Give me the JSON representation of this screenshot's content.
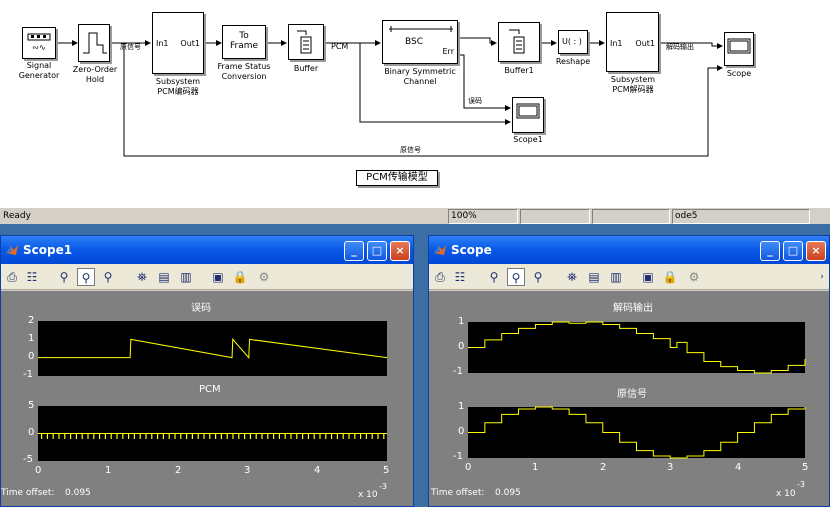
{
  "model": {
    "blocks": {
      "signal_generator": "Signal\nGenerator",
      "zero_order_hold": "Zero-Order\nHold",
      "subsystem_enc": "Subsystem\nPCM编码器",
      "frame_status": "Frame Status\nConversion",
      "frame_status_icon": "To\nFrame",
      "buffer": "Buffer",
      "bsc": "Binary Symmetric\nChannel",
      "bsc_icon": "BSC",
      "buffer1": "Buffer1",
      "reshape": "Reshape",
      "reshape_icon": "U( : )",
      "subsystem_dec": "Subsystem\nPCM解码器",
      "scope": "Scope",
      "scope1": "Scope1"
    },
    "ports": {
      "in1": "In1",
      "out1": "Out1",
      "err": "Err"
    },
    "signals": {
      "pcm": "PCM",
      "orig": "原信号",
      "orig2": "原信号",
      "err": "误码",
      "dec": "解码输出"
    },
    "caption": "PCM传输模型"
  },
  "statusbar": {
    "status": "Ready",
    "zoom": "100%",
    "solver": "ode5"
  },
  "scope1": {
    "title": "Scope1",
    "plots": [
      {
        "title": "误码",
        "yticks": [
          "2",
          "1",
          "0",
          "-1"
        ]
      },
      {
        "title": "PCM",
        "yticks": [
          "5",
          "0",
          "-5"
        ]
      }
    ],
    "xticks": [
      "0",
      "1",
      "2",
      "3",
      "4",
      "5"
    ],
    "xexp": "x 10",
    "xexp_power": "-3",
    "time_offset_label": "Time offset:",
    "time_offset_value": "0.095"
  },
  "scope": {
    "title": "Scope",
    "plots": [
      {
        "title": "解码输出",
        "yticks": [
          "1",
          "0",
          "-1"
        ]
      },
      {
        "title": "原信号",
        "yticks": [
          "1",
          "0",
          "-1"
        ]
      }
    ],
    "xticks": [
      "0",
      "1",
      "2",
      "3",
      "4",
      "5"
    ],
    "xexp": "x 10",
    "xexp_power": "-3",
    "time_offset_label": "Time offset:",
    "time_offset_value": "0.095"
  },
  "colors": {
    "trace": "#ffff00",
    "axes_bg": "#000000",
    "figure_bg": "#808080",
    "titlebar": "#0a5ce8"
  },
  "chart_data": [
    {
      "type": "line",
      "title": "误码",
      "x": [
        0,
        1.32,
        1.33,
        2.78,
        2.79,
        3.02,
        3.03,
        5
      ],
      "series": [
        {
          "values": [
            0,
            0,
            1,
            0,
            1,
            0,
            1,
            0
          ]
        }
      ],
      "xlim": [
        0,
        5
      ],
      "ylim": [
        -1,
        2
      ],
      "grid": false
    },
    {
      "type": "line",
      "title": "PCM",
      "x": [
        0,
        5
      ],
      "series": [
        {
          "values": [
            0,
            0
          ]
        }
      ],
      "xlim": [
        0,
        5
      ],
      "ylim": [
        -5,
        5
      ],
      "grid": false
    },
    {
      "type": "line",
      "title": "解码输出",
      "x": [
        0,
        0.25,
        0.5,
        0.75,
        1.0,
        1.25,
        1.5,
        1.75,
        2.0,
        2.25,
        2.5,
        2.75,
        3.0,
        3.1,
        3.25,
        3.5,
        3.75,
        4.0,
        4.25,
        4.5,
        4.75,
        5.0
      ],
      "series": [
        {
          "values": [
            0,
            0.3,
            0.55,
            0.75,
            0.9,
            1.0,
            0.95,
            1.0,
            0.9,
            0.75,
            0.55,
            0.35,
            0.0,
            0.2,
            -0.2,
            -0.55,
            -0.75,
            -0.9,
            -1.0,
            -0.9,
            -0.7,
            -0.45
          ]
        }
      ],
      "xlim": [
        0,
        5
      ],
      "ylim": [
        -1,
        1
      ],
      "grid": false
    },
    {
      "type": "line",
      "title": "原信号",
      "x": [
        0,
        0.25,
        0.5,
        0.75,
        1.0,
        1.25,
        1.5,
        1.75,
        2.0,
        2.25,
        2.5,
        2.75,
        3.0,
        3.25,
        3.5,
        3.75,
        4.0,
        4.25,
        4.5,
        4.75,
        5.0
      ],
      "series": [
        {
          "values": [
            0,
            0.38,
            0.71,
            0.92,
            1.0,
            0.92,
            0.71,
            0.38,
            0.0,
            -0.38,
            -0.71,
            -0.92,
            -1.0,
            -0.92,
            -0.71,
            -0.38,
            0.0,
            0.38,
            0.71,
            0.92,
            1.0
          ]
        }
      ],
      "xlim": [
        0,
        5
      ],
      "ylim": [
        -1,
        1
      ],
      "grid": false
    }
  ]
}
